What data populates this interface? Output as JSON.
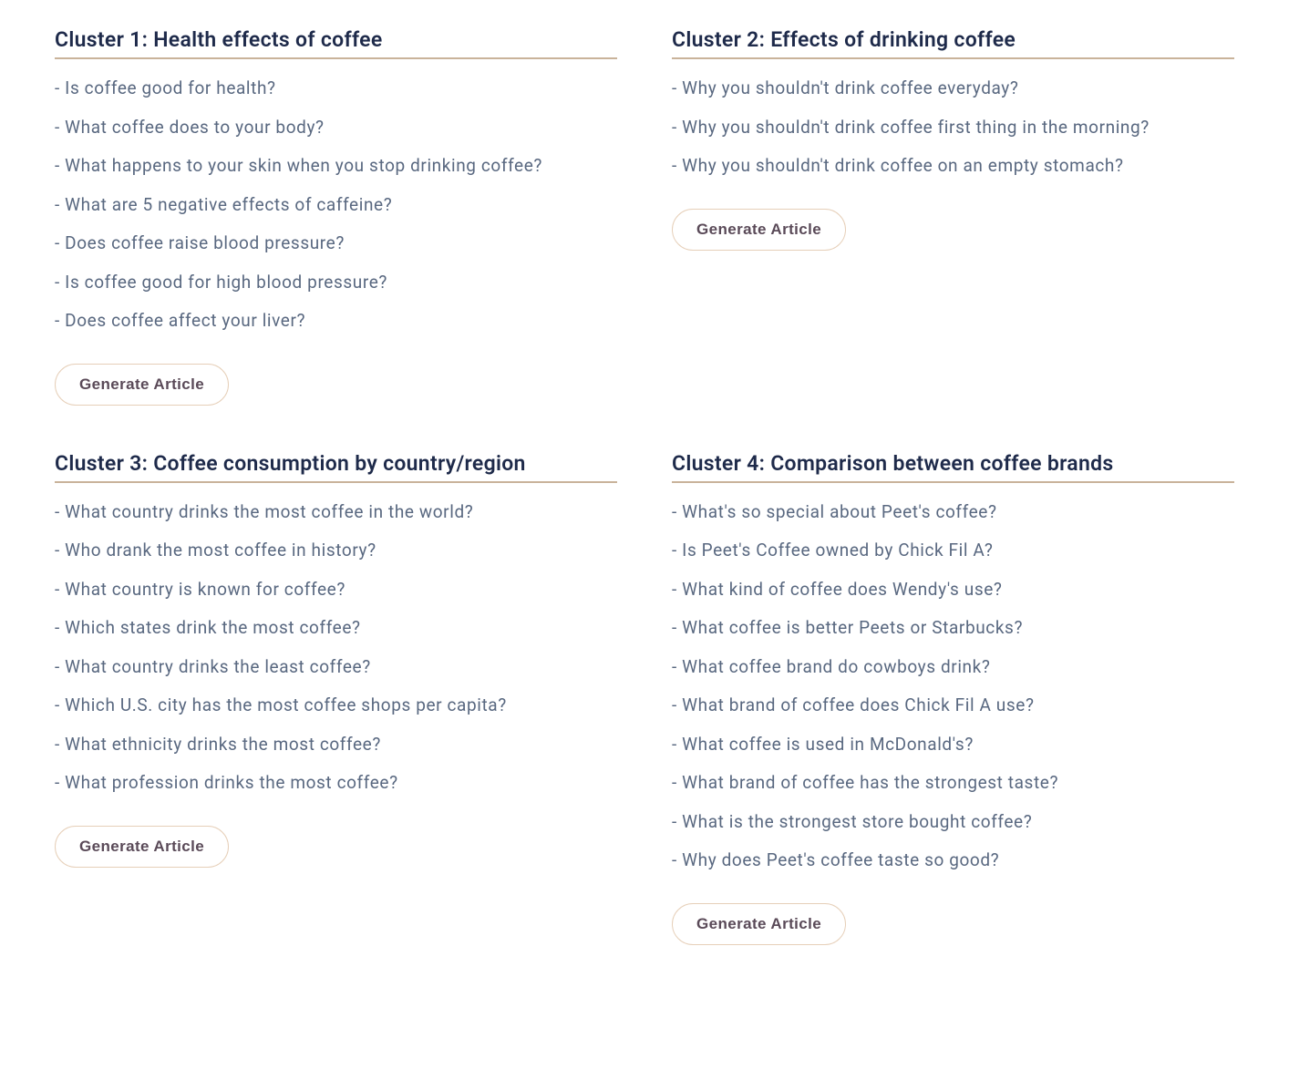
{
  "button_label": "Generate Article",
  "clusters": [
    {
      "title": "Cluster 1: Health effects of coffee",
      "questions": [
        "Is coffee good for health?",
        "What coffee does to your body?",
        "What happens to your skin when you stop drinking coffee?",
        "What are 5 negative effects of caffeine?",
        "Does coffee raise blood pressure?",
        "Is coffee good for high blood pressure?",
        "Does coffee affect your liver?"
      ]
    },
    {
      "title": "Cluster 2: Effects of drinking coffee",
      "questions": [
        "Why you shouldn't drink coffee everyday?",
        "Why you shouldn't drink coffee first thing in the morning?",
        "Why you shouldn't drink coffee on an empty stomach?"
      ]
    },
    {
      "title": "Cluster 3: Coffee consumption by country/region",
      "questions": [
        "What country drinks the most coffee in the world?",
        "Who drank the most coffee in history?",
        "What country is known for coffee?",
        "Which states drink the most coffee?",
        "What country drinks the least coffee?",
        "Which U.S. city has the most coffee shops per capita?",
        "What ethnicity drinks the most coffee?",
        "What profession drinks the most coffee?"
      ]
    },
    {
      "title": "Cluster 4: Comparison between coffee brands",
      "questions": [
        "What's so special about Peet's coffee?",
        "Is Peet's Coffee owned by Chick Fil A?",
        "What kind of coffee does Wendy's use?",
        "What coffee is better Peets or Starbucks?",
        "What coffee brand do cowboys drink?",
        "What brand of coffee does Chick Fil A use?",
        "What coffee is used in McDonald's?",
        "What brand of coffee has the strongest taste?",
        "What is the strongest store bought coffee?",
        "Why does Peet's coffee taste so good?"
      ]
    }
  ]
}
